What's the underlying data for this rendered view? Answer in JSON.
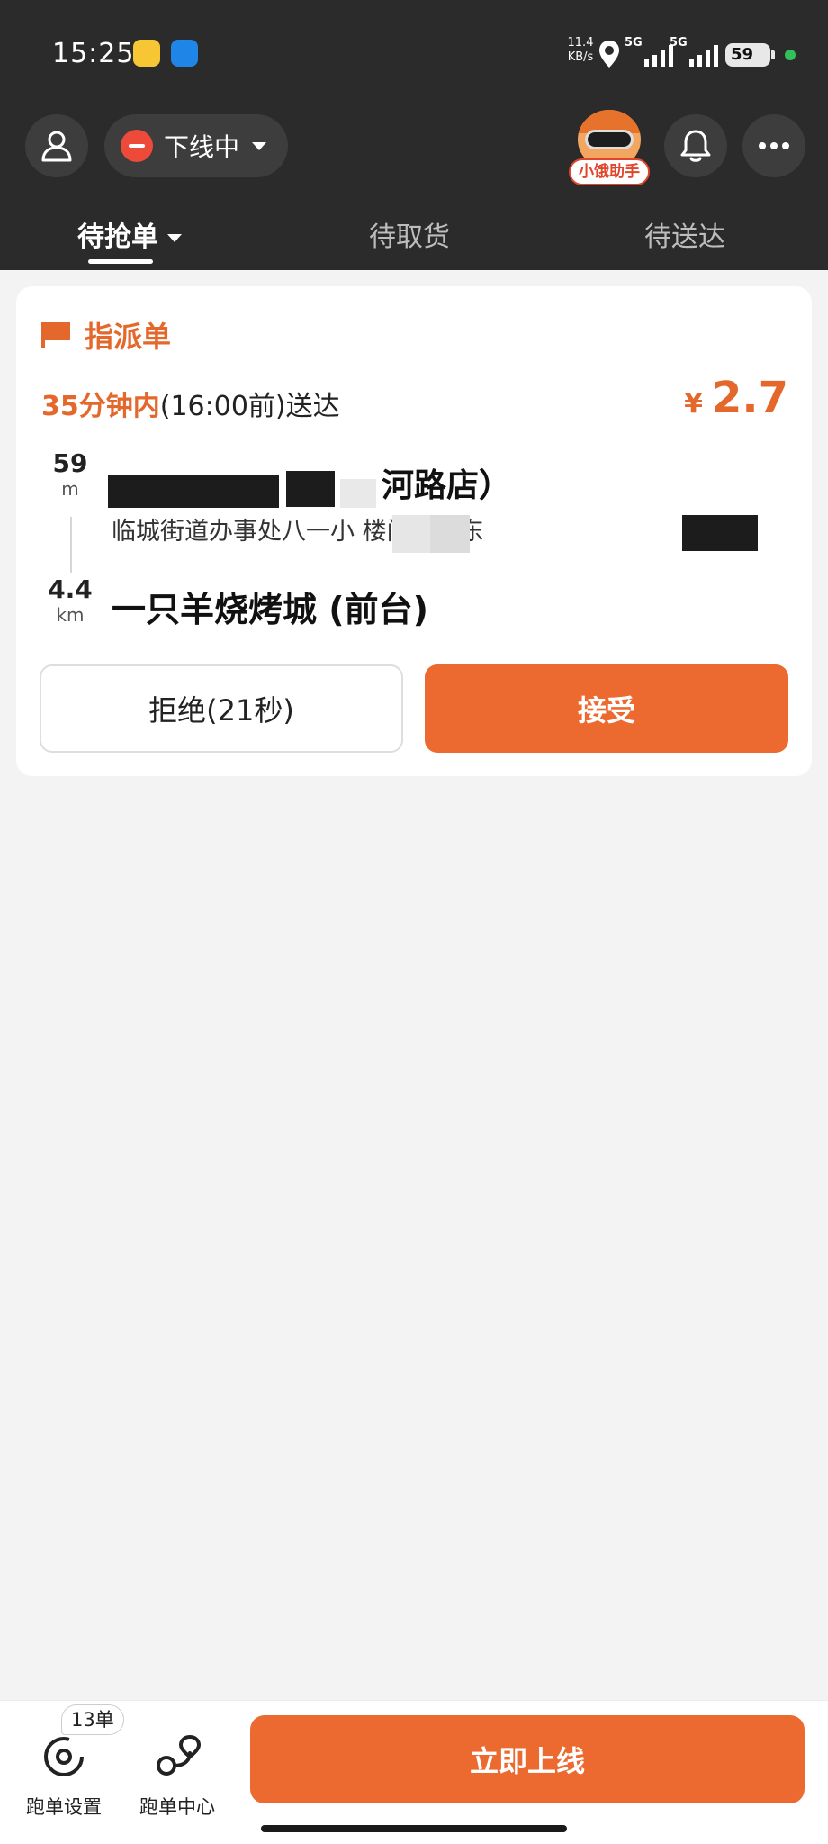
{
  "status_bar": {
    "time": "15:25",
    "net_speed_value": "11.4",
    "net_speed_unit": "KB/s",
    "signal_1": "5G",
    "signal_2": "5G",
    "battery": "59"
  },
  "header": {
    "status_label": "下线中",
    "assistant_label": "小饿助手",
    "icons": {
      "user": "user-icon",
      "bell": "bell-icon",
      "more": "more-icon"
    }
  },
  "tabs": [
    {
      "label": "待抢单",
      "active": true
    },
    {
      "label": "待取货",
      "active": false
    },
    {
      "label": "待送达",
      "active": false
    }
  ],
  "order": {
    "type_label": "指派单",
    "time_accent": "35分钟内",
    "time_rest": "(16:00前)送达",
    "price_currency": "¥",
    "price_amount": "2.7",
    "pickup": {
      "distance": "59",
      "distance_unit": "m",
      "name": "河路店）",
      "address": "临城街道办事处八一小     楼门市房东"
    },
    "dropoff": {
      "distance": "4.4",
      "distance_unit": "km",
      "name": "一只羊烧烤城 (前台)"
    },
    "reject_label": "拒绝(21秒)",
    "accept_label": "接受"
  },
  "bottom_bar": {
    "settings_label": "跑单设置",
    "settings_badge": "13单",
    "center_label": "跑单中心",
    "go_online_label": "立即上线"
  },
  "colors": {
    "accent": "#ec6a2f",
    "header_bg": "#2b2b2b",
    "offline": "#ee4a3a"
  }
}
